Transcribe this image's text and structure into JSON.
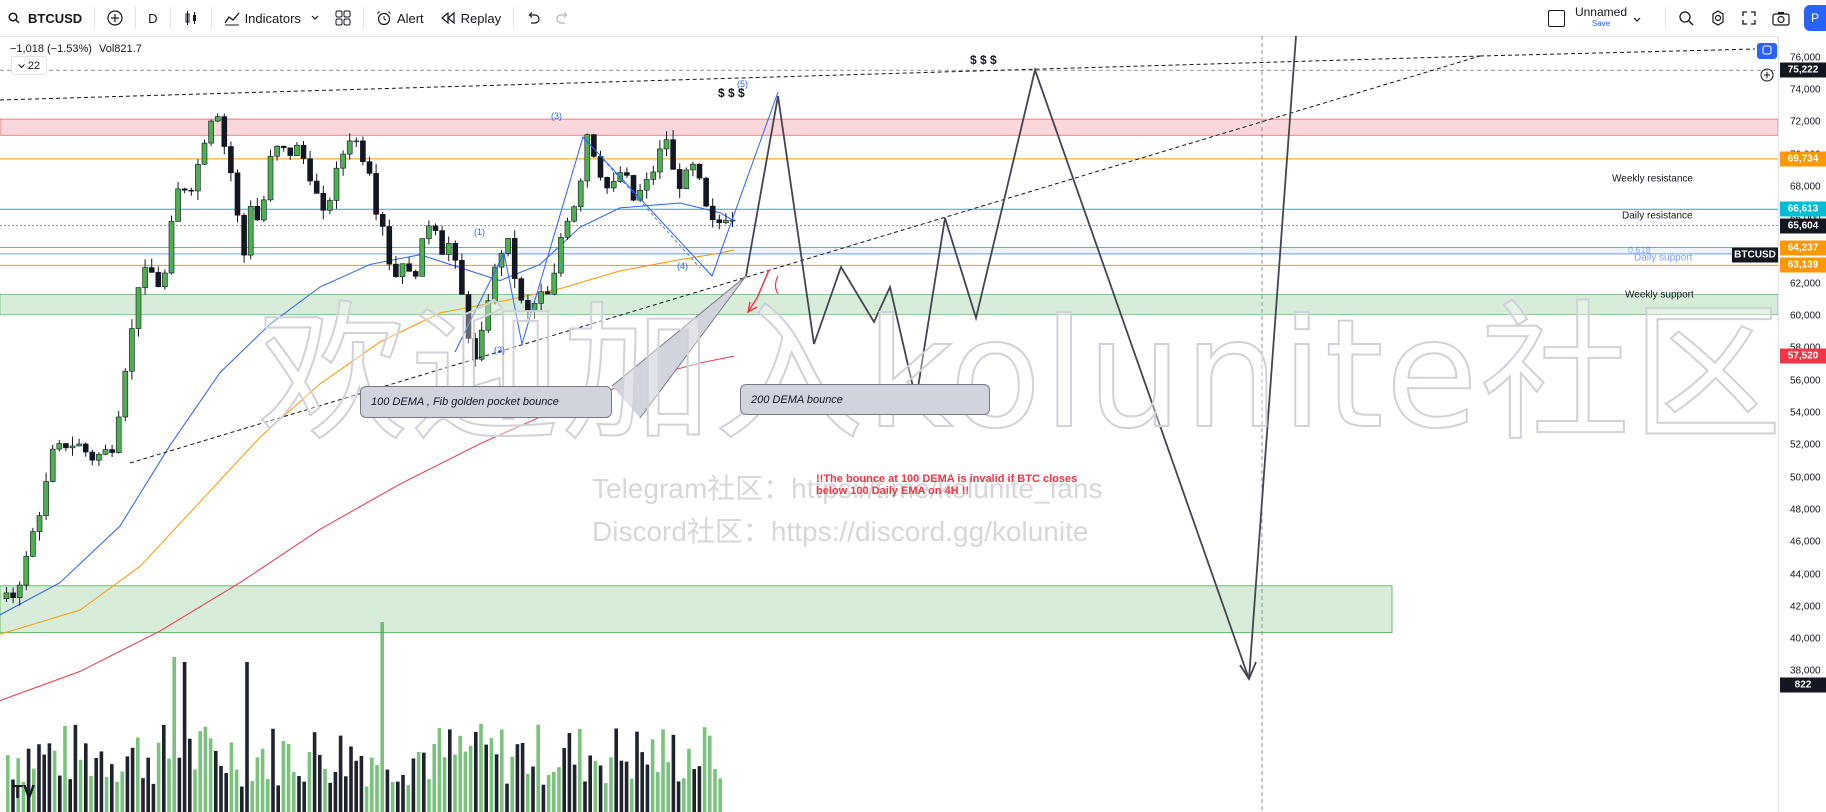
{
  "toolbar": {
    "symbol": "BTCUSD",
    "interval": "D",
    "indicators_label": "Indicators",
    "alert_label": "Alert",
    "replay_label": "Replay",
    "layout_name": "Unnamed",
    "layout_status": "Save",
    "publish_label": "P"
  },
  "legend": {
    "change": "−1,018 (−1.53%)",
    "volume": "Vol821.7",
    "indicator_count": "22"
  },
  "price_axis": {
    "ticks": [
      "76,000",
      "74,000",
      "72,000",
      "70,000",
      "68,000",
      "66,000",
      "64,000",
      "62,000",
      "60,000",
      "58,000",
      "56,000",
      "54,000",
      "52,000",
      "50,000",
      "48,000",
      "46,000",
      "44,000",
      "42,000",
      "40,000",
      "38,000"
    ],
    "tick_values": [
      76000,
      74000,
      72000,
      70000,
      68000,
      66000,
      64000,
      62000,
      60000,
      58000,
      56000,
      54000,
      52000,
      50000,
      48000,
      46000,
      44000,
      42000,
      40000,
      38000
    ],
    "badges": [
      {
        "text": "75,222",
        "value": 75222,
        "bg": "#131722"
      },
      {
        "text": "69,734",
        "value": 69734,
        "bg": "#ff9800"
      },
      {
        "text": "66,613",
        "value": 66613,
        "bg": "#00bcd4"
      },
      {
        "text": "65,604",
        "value": 65604,
        "bg": "#131722"
      },
      {
        "text": "64,237",
        "value": 64237,
        "bg": "#ff9800"
      },
      {
        "text": "63,139",
        "value": 63139,
        "bg": "#ff9800"
      },
      {
        "text": "57,520",
        "value": 57520,
        "bg": "#f23645"
      },
      {
        "text": "822",
        "value": 37150,
        "bg": "#131722"
      }
    ],
    "symbol_tag": "BTCUSD"
  },
  "levels": {
    "weekly_resistance": "Weekly resistance",
    "daily_resistance": "Daily resistance",
    "daily_support": "Daily support",
    "weekly_support": "Weekly support",
    "fib_label": "0.618"
  },
  "annotations": {
    "callout_100": "100 DEMA , Fib golden pocket bounce",
    "callout_200": "200 DEMA bounce",
    "warning_line1": "!!The bounce at 100 DEMA is invalid if BTC closes",
    "warning_line2": "below 100 Daily EMA on 4H !!",
    "liquidity_1": "$ $ $",
    "liquidity_2": "$ $ $",
    "wave_1": "(1)",
    "wave_2": "(2)",
    "wave_3": "(3)",
    "wave_4": "(4)",
    "wave_5": "(5)"
  },
  "watermark": {
    "big": "欢迎加入kolunite社区",
    "telegram": "Telegram社区：https://t.me/kolunite_fans",
    "discord": "Discord社区：https://discord.gg/kolunite"
  },
  "colors": {
    "up": "#26a69a",
    "candle_up": "#4caf50",
    "candle_down": "#131722",
    "resistance_zone": "#f8c9cd",
    "support_zone": "#c8e6c9",
    "ema50": "#2962ff",
    "ema100": "#ff9800",
    "ema200": "#f23645"
  }
}
